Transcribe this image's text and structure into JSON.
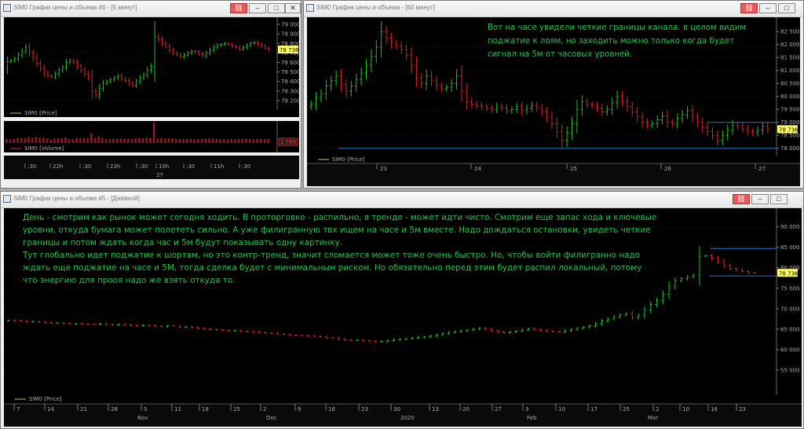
{
  "windows": {
    "w1": {
      "title": "SiM0 График цены и объема #6 - [5 минут]"
    },
    "w2": {
      "title": "SiM0 График цены и объема - [60 минут]"
    },
    "w3": {
      "title": "SiM0 График цены и объема #5 - [Дневной]"
    }
  },
  "buttons": {
    "link": "⛓",
    "minimize": "–",
    "maximize": "□",
    "close": "✕"
  },
  "w1": {
    "price_legend": "SiM0 [Price]",
    "volume_legend": "SiM0 [Volume]",
    "last_price": "78 736",
    "last_volume": "1 769",
    "yticks": [
      "79 000",
      "78 900",
      "78 800",
      "78 700",
      "78 600",
      "78 500",
      "78 400",
      "78 300",
      "78 200"
    ],
    "time_top": [
      ":30",
      "22h",
      ":30",
      "23h",
      ":30",
      "10h",
      ":30",
      "11h",
      ":30"
    ],
    "time_bottom": [
      "27"
    ]
  },
  "w2": {
    "legend": "SiM0 [Price]",
    "annotation": "Вот на часе увидели четкие границы канала. в целом видим поджатие к лоям, но заходить можно только когда будет сигнал на 5м от часовых уровней.",
    "last_price": "78 736",
    "yticks": [
      "82 500",
      "82 000",
      "81 500",
      "81 000",
      "80 500",
      "80 000",
      "79 500",
      "79 000",
      "78 500",
      "78 000"
    ],
    "xticks": [
      "23",
      "24",
      "25",
      "26",
      "27"
    ]
  },
  "w3": {
    "legend": "SiM0 [Price]",
    "annotation": "День - смотрим как рынок может сегодня ходить. В проторговке - распильно, в тренде - может идти чисто. Смотрим еще запас хода и ключевые уровни, откуда бумага может полететь сильно. А уже филигранную твх ищем на часе и 5м вместе. Надо дождаться остановки, увидеть четкие границы и потом ждать когда час и 5м будут показывать одну картинку.\nТут глобально идет поджатие к шортам, но это контр-тренд, значит сломается может тоже очень быстро. Но, чтобы войти филигранно надо ждать еще поджатие на часе и 5М, тогда сделка будет с минимальным риском. Но обязательно перед этим будет распил локальный, потому что энергию для прооя надо же взять откуда то.",
    "last_price": "78 736",
    "yticks": [
      "90 000",
      "85 000",
      "80 000",
      "75 000",
      "70 000",
      "65 000",
      "60 000",
      "55 000"
    ],
    "xticks": [
      "7",
      "14",
      "21",
      "28",
      "5",
      "11",
      "18",
      "25",
      "2",
      "9",
      "16",
      "23",
      "30",
      "13",
      "20",
      "27",
      "3",
      "10",
      "17",
      "25",
      "2",
      "10",
      "16",
      "23"
    ],
    "months": [
      "Nov",
      "Dec",
      "2020",
      "Feb",
      "Mar"
    ]
  },
  "colors": {
    "up": "#1fbf1f",
    "down": "#d2232a",
    "channel": "#1e78c8",
    "annotation": "#22c04a"
  },
  "chart_data": [
    {
      "type": "candlestick",
      "title": "SiM0 График цены и объема #6 - [5 минут]",
      "ylim": [
        78150,
        79050
      ],
      "series": [
        {
          "name": "SiM0 [Price]",
          "close_values": [
            78610,
            78620,
            78640,
            78680,
            78720,
            78760,
            78700,
            78650,
            78590,
            78540,
            78490,
            78460,
            78450,
            78480,
            78520,
            78550,
            78600,
            78620,
            78600,
            78560,
            78520,
            78480,
            78440,
            78300,
            78260,
            78330,
            78380,
            78400,
            78420,
            78440,
            78460,
            78430,
            78410,
            78380,
            78360,
            78400,
            78440,
            78470,
            78520,
            78560,
            78870,
            78840,
            78800,
            78770,
            78730,
            78700,
            78680,
            78660,
            78680,
            78700,
            78720,
            78710,
            78690,
            78670,
            78700,
            78730,
            78760,
            78780,
            78790,
            78800,
            78790,
            78770,
            78760,
            78740,
            78760,
            78780,
            78800,
            78810,
            78790,
            78770,
            78750,
            78736
          ]
        }
      ]
    },
    {
      "type": "candlestick",
      "title": "SiM0 График цены и объема - [60 минут]",
      "ylim": [
        77900,
        82750
      ],
      "series": [
        {
          "name": "SiM0 [Price]",
          "close_values": [
            79700,
            79950,
            80100,
            80400,
            80600,
            80800,
            80450,
            80200,
            80400,
            80650,
            80900,
            81200,
            81550,
            81900,
            82500,
            82250,
            82050,
            81950,
            81800,
            81600,
            81200,
            80700,
            80500,
            80800,
            80600,
            80400,
            80300,
            80350,
            80500,
            80800,
            80200,
            79800,
            79700,
            79650,
            79600,
            79550,
            79500,
            79600,
            79550,
            79450,
            79500,
            79600,
            79450,
            79550,
            79650,
            79550,
            79400,
            79200,
            78950,
            78650,
            78300,
            78600,
            78950,
            79500,
            79800,
            79700,
            79650,
            79550,
            79400,
            79500,
            79750,
            80000,
            79800,
            79600,
            79400,
            79200,
            79000,
            78900,
            78950,
            79100,
            79250,
            79000,
            78950,
            79150,
            79300,
            79450,
            79200,
            79000,
            78800,
            78650,
            78500,
            78300,
            78500,
            78700,
            78900,
            78850,
            78750,
            78650,
            78600,
            78700,
            78850,
            78736
          ]
        }
      ],
      "levels": [
        79000,
        78000
      ]
    },
    {
      "type": "candlestick",
      "title": "SiM0 График цены и объема #5 - [Дневной]",
      "ylim": [
        50000,
        93000
      ],
      "series": [
        {
          "name": "SiM0 [Price]",
          "close_values": [
            67100,
            67050,
            66950,
            66800,
            66850,
            66700,
            66550,
            66450,
            66500,
            66400,
            66300,
            66350,
            66250,
            66200,
            66150,
            66300,
            66100,
            66000,
            66150,
            66050,
            65900,
            65800,
            65900,
            65850,
            65700,
            65600,
            65800,
            65700,
            65500,
            65550,
            65400,
            65200,
            65050,
            64900,
            64800,
            64700,
            64600,
            64650,
            64500,
            64400,
            64300,
            64150,
            64050,
            63950,
            63800,
            63700,
            63550,
            63450,
            63400,
            63300,
            63250,
            63100,
            62900,
            62850,
            62550,
            62400,
            62250,
            62300,
            62150,
            62050,
            61900,
            62000,
            62200,
            62400,
            62500,
            62650,
            62800,
            63000,
            63100,
            63300,
            63600,
            63900,
            64200,
            64400,
            64600,
            64800,
            65000,
            65200,
            65000,
            64600,
            64300,
            64100,
            64300,
            64500,
            64800,
            65100,
            64900,
            64700,
            64500,
            64400,
            64300,
            64600,
            64900,
            65200,
            65500,
            65800,
            66300,
            67000,
            67500,
            68000,
            68500,
            68800,
            67800,
            68400,
            69700,
            71000,
            72000,
            73500,
            75500,
            76800,
            77300,
            77800,
            78200,
            82800,
            82900,
            82300,
            81500,
            80500,
            79800,
            79400,
            79100,
            78800,
            78736
          ]
        }
      ],
      "levels": [
        84700,
        80800,
        78000
      ]
    }
  ]
}
